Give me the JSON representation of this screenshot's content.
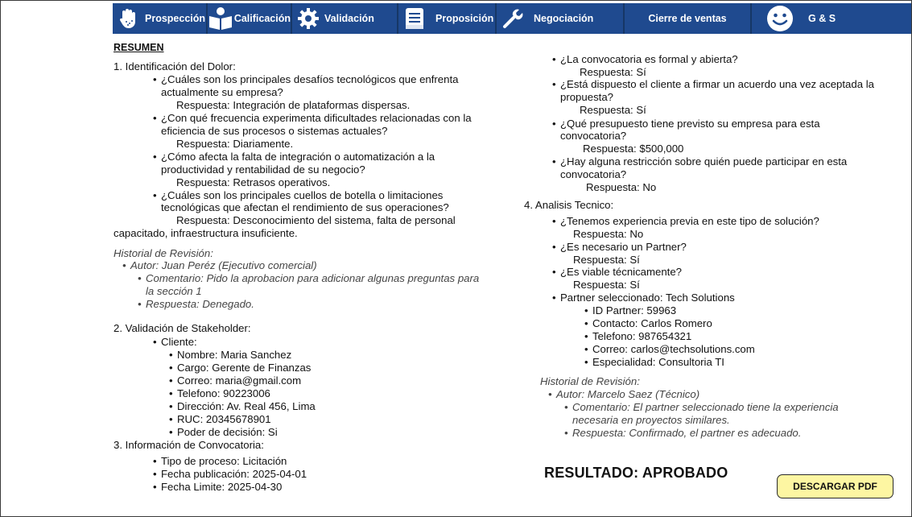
{
  "nav": {
    "items": [
      {
        "label": "Prospección"
      },
      {
        "label": "Calificación"
      },
      {
        "label": "Validación"
      },
      {
        "label": "Proposición"
      },
      {
        "label": "Negociación"
      },
      {
        "label": "Cierre de ventas"
      },
      {
        "label": "G & S"
      }
    ]
  },
  "summary": {
    "title": "RESUMEN",
    "s1": {
      "heading": "1. Identificación del Dolor:",
      "q1a": "¿Cuáles son los principales desafíos tecnológicos que enfrenta",
      "q1b": "actualmente su empresa?",
      "r1": "Respuesta: Integración de plataformas dispersas.",
      "q2a": "¿Con qué frecuencia experimenta dificultades relacionadas con la",
      "q2b": "eficiencia de sus procesos o sistemas actuales?",
      "r2": "Respuesta: Diariamente.",
      "q3a": "¿Cómo afecta la falta de integración o automatización a la",
      "q3b": "productividad y rentabilidad de su negocio?",
      "r3": "Respuesta: Retrasos operativos.",
      "q4a": "¿Cuáles son los principales cuellos de botella o limitaciones",
      "q4b": "tecnológicas que afectan el rendimiento de sus operaciones?",
      "r4a": "Respuesta: Desconocimiento del sistema, falta de personal",
      "r4b": "capacitado, infraestructura insuficiente.",
      "history": {
        "title": "Historial de Revisión:",
        "author": "Autor: Juan Peréz (Ejecutivo comercial)",
        "comment_a": "Comentario: Pido la aprobacion para adicionar algunas preguntas para",
        "comment_b": "la sección 1",
        "response": "Respuesta: Denegado."
      }
    },
    "s2": {
      "heading": "2. Validación de Stakeholder:",
      "client": "Cliente:",
      "name": "Nombre: Maria Sanchez",
      "role": "Cargo: Gerente de Finanzas",
      "email": "Correo: maria@gmail.com",
      "phone": "Telefono: 90223006",
      "address": "Dirección: Av. Real 456, Lima",
      "ruc": "RUC: 20345678901",
      "power": "Poder de decisión: Si"
    },
    "s3": {
      "heading": "3. Información de Convocatoria:",
      "process": "Tipo de proceso: Licitación",
      "pub": "Fecha publicación: 2025-04-01",
      "limit": "Fecha Limite: 2025-04-30",
      "q1": "¿La convocatoria es formal y abierta?",
      "r1": "Respuesta: Sí",
      "q2a": "¿Está dispuesto el cliente a firmar un acuerdo una vez aceptada la",
      "q2b": "propuesta?",
      "r2": "Respuesta: Sí",
      "q3a": "¿Qué presupuesto tiene previsto su empresa para esta",
      "q3b": "convocatoria?",
      "r3": "Respuesta: $500,000",
      "q4a": "¿Hay alguna restricción sobre quién puede participar en esta",
      "q4b": "convocatoria?",
      "r4": "Respuesta: No"
    },
    "s4": {
      "heading": "4. Analisis Tecnico:",
      "q1": "¿Tenemos experiencia previa en este tipo de solución?",
      "r1": "Respuesta: No",
      "q2": "¿Es necesario un Partner?",
      "r2": "Respuesta: Sí",
      "q3": "¿Es viable técnicamente?",
      "r3": "Respuesta: Sí",
      "partner": "Partner seleccionado: Tech Solutions",
      "p_id": "ID Partner: 59963",
      "p_contact": "Contacto: Carlos Romero",
      "p_phone": "Telefono: 987654321",
      "p_email": "Correo: carlos@techsolutions.com",
      "p_spec": "Especialidad: Consultoria TI",
      "history": {
        "title": "Historial de Revisión:",
        "author": "Autor: Marcelo Saez (Técnico)",
        "comment_a": "Comentario: El partner seleccionado tiene la experiencia",
        "comment_b": "necesaria en proyectos similares.",
        "response": "Respuesta: Confirmado, el partner es adecuado."
      }
    }
  },
  "result": "RESULTADO: APROBADO",
  "download_label": "DESCARGAR PDF",
  "colors": {
    "nav_bg": "#1f4a8f",
    "button_bg": "#fdf6a2"
  }
}
